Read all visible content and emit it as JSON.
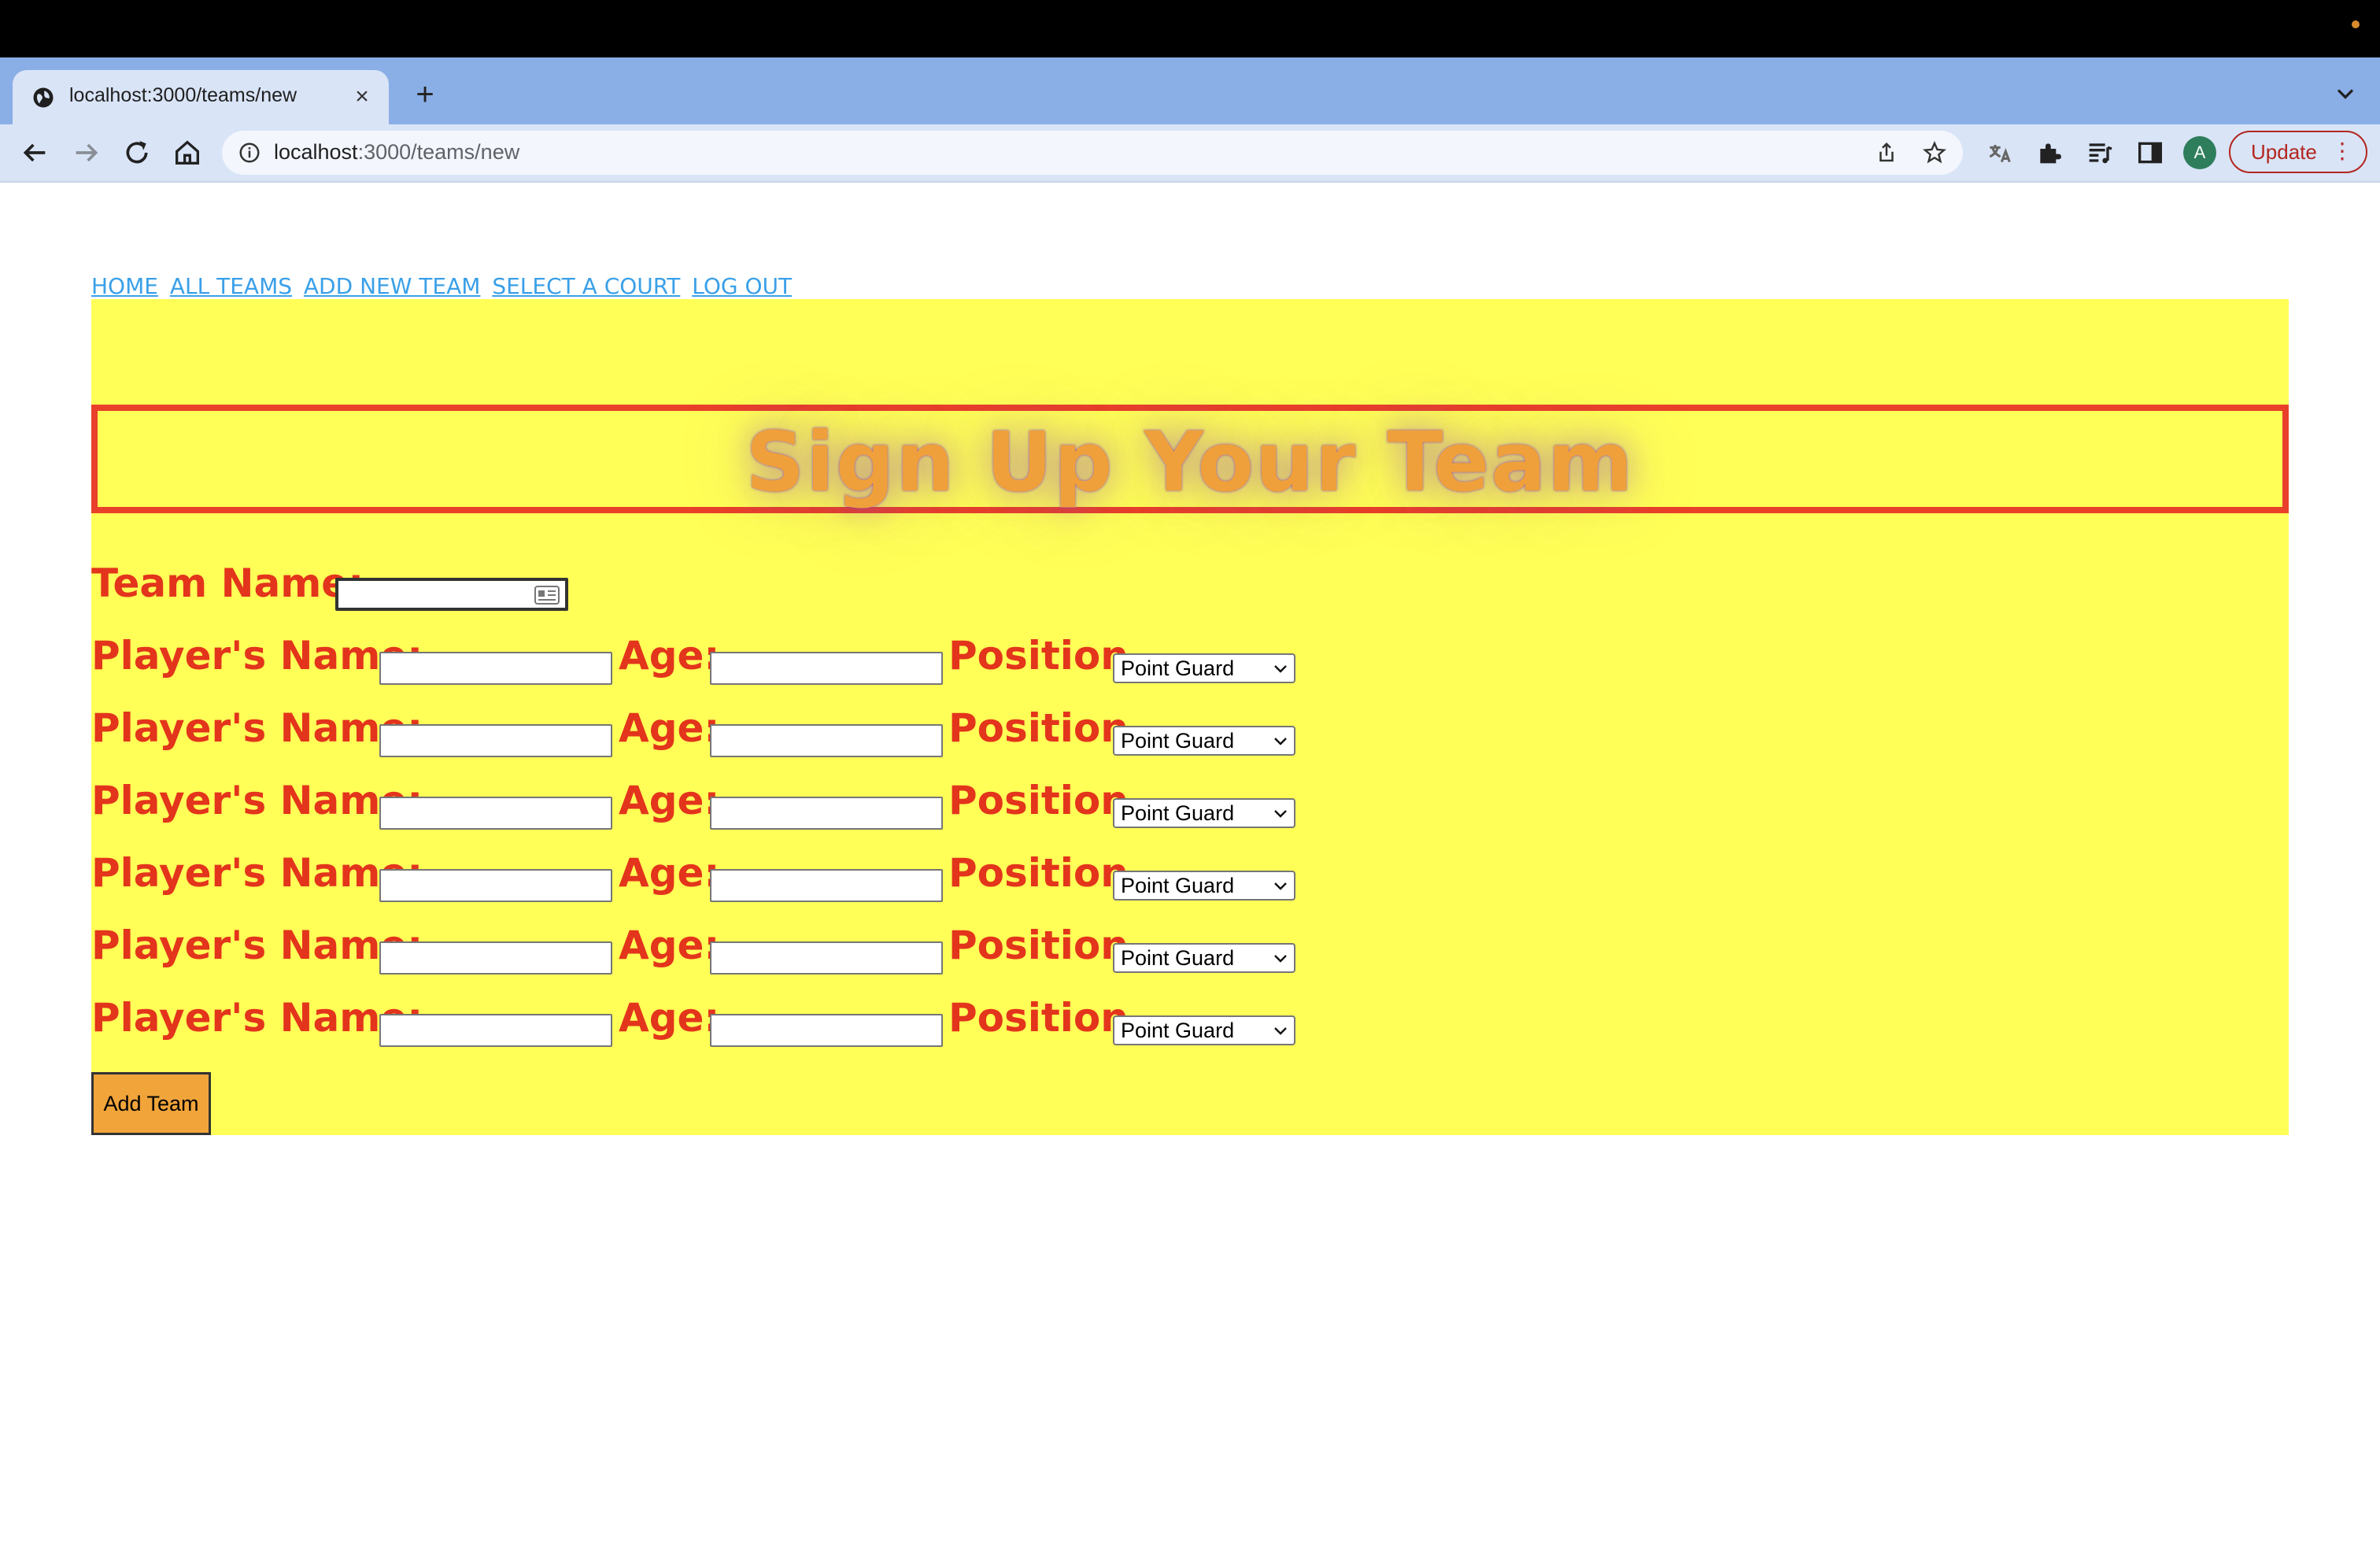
{
  "browser": {
    "tab_title": "localhost:3000/teams/new",
    "url_host": "localhost",
    "url_path": ":3000/teams/new",
    "profile_initial": "A",
    "update_label": "Update"
  },
  "nav": {
    "links": [
      "HOME",
      "ALL TEAMS",
      "ADD NEW TEAM",
      "SELECT A COURT",
      "LOG OUT"
    ]
  },
  "page": {
    "headline": "Sign Up Your Team",
    "team_name_label": "Team Name:",
    "team_name_value": ""
  },
  "players": [
    {
      "name_label": "Player's Name:",
      "name_value": "",
      "age_label": "Age:",
      "age_value": "",
      "position_label": "Position",
      "position_value": "Point Guard"
    },
    {
      "name_label": "Player's Name:",
      "name_value": "",
      "age_label": "Age:",
      "age_value": "",
      "position_label": "Position",
      "position_value": "Point Guard"
    },
    {
      "name_label": "Player's Name:",
      "name_value": "",
      "age_label": "Age:",
      "age_value": "",
      "position_label": "Position",
      "position_value": "Point Guard"
    },
    {
      "name_label": "Player's Name:",
      "name_value": "",
      "age_label": "Age:",
      "age_value": "",
      "position_label": "Position",
      "position_value": "Point Guard"
    },
    {
      "name_label": "Player's Name:",
      "name_value": "",
      "age_label": "Age:",
      "age_value": "",
      "position_label": "Position",
      "position_value": "Point Guard"
    },
    {
      "name_label": "Player's Name:",
      "name_value": "",
      "age_label": "Age:",
      "age_value": "",
      "position_label": "Position",
      "position_value": "Point Guard"
    }
  ],
  "submit_label": "Add Team",
  "colors": {
    "panel_bg": "#ffff57",
    "label_red": "#e3341c",
    "headline_orange": "#f0a03a",
    "link_blue": "#3aa0e8",
    "button_orange": "#f0a43a"
  }
}
